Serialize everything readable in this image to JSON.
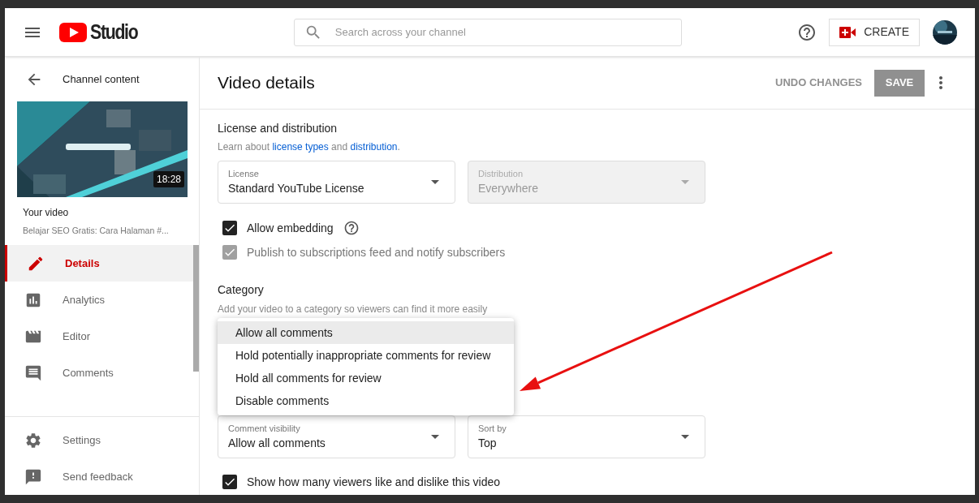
{
  "header": {
    "logo_text": "Studio",
    "search": {
      "placeholder": "Search across your channel"
    },
    "create_label": "CREATE"
  },
  "sidebar": {
    "back_label": "Channel content",
    "video": {
      "duration": "18:28",
      "heading": "Your video",
      "title": "Belajar SEO Gratis: Cara Halaman #..."
    },
    "nav": [
      {
        "label": "Details",
        "kind": "edit",
        "selected": true
      },
      {
        "label": "Analytics",
        "kind": "analytics",
        "selected": false
      },
      {
        "label": "Editor",
        "kind": "editor",
        "selected": false
      },
      {
        "label": "Comments",
        "kind": "comments",
        "selected": false
      }
    ],
    "footer": [
      {
        "label": "Settings",
        "kind": "settings"
      },
      {
        "label": "Send feedback",
        "kind": "feedback"
      }
    ]
  },
  "main": {
    "title": "Video details",
    "undo_label": "UNDO CHANGES",
    "save_label": "SAVE",
    "license_section": {
      "heading": "License and distribution",
      "help": [
        {
          "kind": "text",
          "text": "Learn about "
        },
        {
          "kind": "link",
          "text": "license types"
        },
        {
          "kind": "text",
          "text": " and "
        },
        {
          "kind": "link",
          "text": "distribution"
        },
        {
          "kind": "text",
          "text": "."
        }
      ],
      "fields": [
        {
          "label": "License",
          "value": "Standard YouTube License",
          "disabled": false
        },
        {
          "label": "Distribution",
          "value": "Everywhere",
          "disabled": true
        }
      ],
      "checkboxes": [
        {
          "label": "Allow embedding",
          "checked": true,
          "disabled": false,
          "help": true
        },
        {
          "label": "Publish to subscriptions feed and notify subscribers",
          "checked": true,
          "disabled": true,
          "help": false
        }
      ]
    },
    "category": {
      "heading": "Category",
      "description": "Add your video to a category so viewers can find it more easily"
    },
    "menu": [
      {
        "label": "Allow all comments",
        "selected": true
      },
      {
        "label": "Hold potentially inappropriate comments for review",
        "selected": false
      },
      {
        "label": "Hold all comments for review",
        "selected": false
      },
      {
        "label": "Disable comments",
        "selected": false
      }
    ],
    "comment_fields": [
      {
        "label": "Comment visibility",
        "value": "Allow all comments",
        "disabled": false
      },
      {
        "label": "Sort by",
        "value": "Top",
        "disabled": false
      }
    ],
    "ratings_checkbox": {
      "label": "Show how many viewers like and dislike this video",
      "checked": true,
      "disabled": false,
      "help": false
    }
  }
}
